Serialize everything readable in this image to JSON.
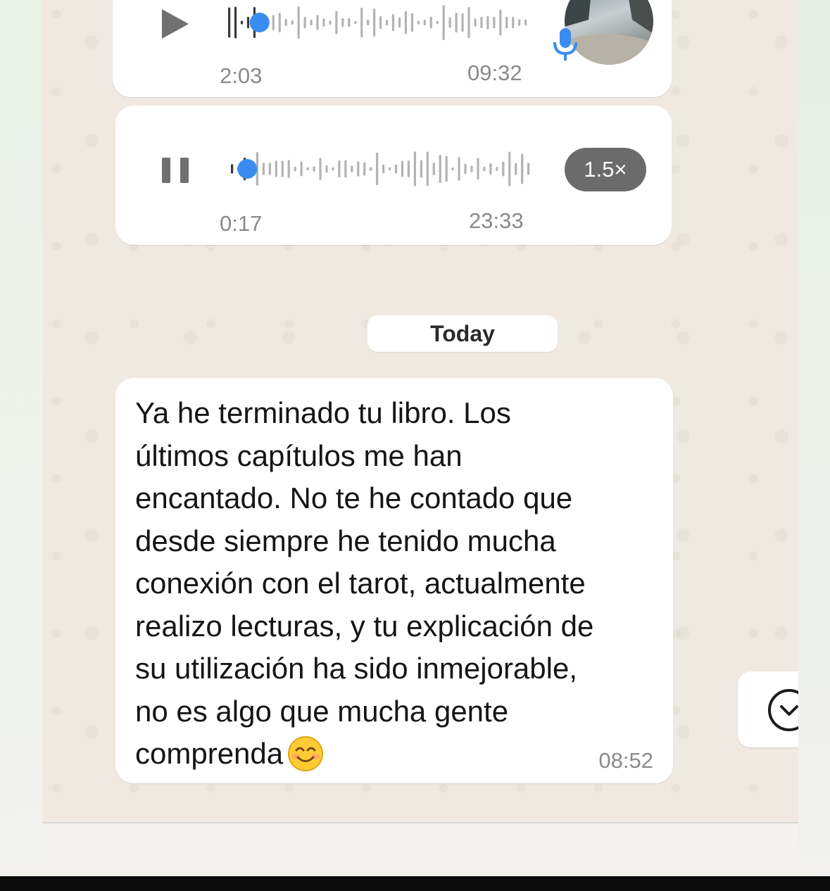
{
  "voice_messages": [
    {
      "duration": "2:03",
      "timestamp": "09:32",
      "state": "paused",
      "progress": 0.09,
      "play_icon": "play-icon",
      "badge_icon": "microphone-icon",
      "accent_color": "#3b8cf0"
    },
    {
      "duration": "0:17",
      "timestamp": "23:33",
      "state": "playing",
      "progress": 0.04,
      "play_icon": "pause-icon",
      "speed_label": "1.5×",
      "accent_color": "#3b8cf0"
    }
  ],
  "date_divider": "Today",
  "message": {
    "text": "Ya he terminado tu libro. Los\núltimos capítulos me han\nencantado. No te he contado que\ndesde siempre he tenido mucha\nconexión con el tarot, actualmente\nrealizo lecturas, y tu explicación de\nsu utilización ha sido inmejorable,\nno es algo que mucha gente\ncomprenda",
    "emoji": "smiling-face-emoji",
    "timestamp": "08:52"
  },
  "scroll_button_icon": "chevron-down-circle-icon",
  "colors": {
    "chat_background": "#efe9e2",
    "bubble": "#ffffff",
    "speed_badge": "#6b6b6b",
    "meta_text": "#8a8a8a"
  }
}
